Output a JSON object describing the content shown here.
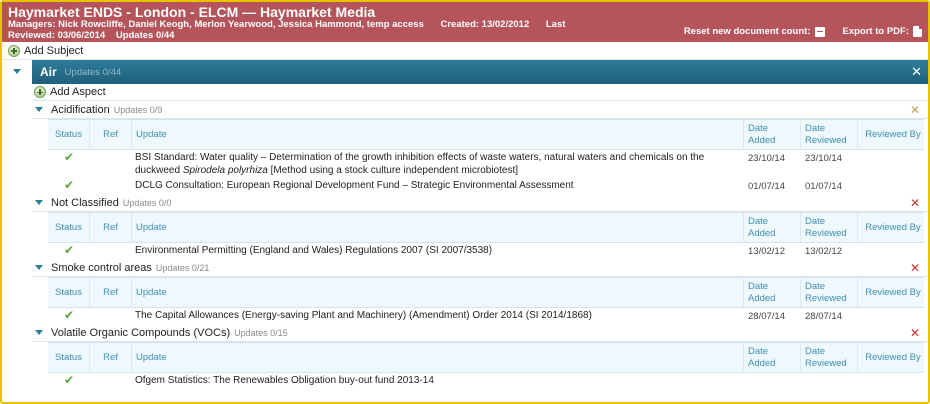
{
  "header": {
    "title": "Haymarket ENDS - London - ELCM —  Haymarket Media",
    "managers": "Managers: Nick Rowcliffe, Daniel Keogh, Merlon Yearwood, Jessica Hammond, temp access",
    "created": "Created: 13/02/2012",
    "last": "Last",
    "reviewed": "Reviewed: 03/06/2014",
    "updates": "Updates 0/44",
    "reset_label": "Reset new document count:",
    "export_label": "Export to PDF:"
  },
  "add_subject_label": "Add Subject",
  "subject": {
    "name": "Air",
    "count": "Updates 0/44",
    "close": "✕"
  },
  "add_aspect_label": "Add Aspect",
  "columns": {
    "status": "Status",
    "ref": "Ref",
    "update": "Update",
    "date_added_1": "Date",
    "date_added_2": "Added",
    "date_reviewed_1": "Date",
    "date_reviewed_2": "Reviewed",
    "reviewed_by": "Reviewed By"
  },
  "aspects": [
    {
      "name": "Acidification",
      "count": "Updates 0/9",
      "rows": [
        {
          "update_line1": "BSI Standard: Water quality – Determination of the growth inhibition effects of waste waters, natural waters and chemicals on the",
          "update_pre": "duckweed ",
          "update_italic": "Spirodela polyrhiza",
          "update_post": " [Method using a stock culture independent microbiotest]",
          "date_added": "23/10/14",
          "date_reviewed": "23/10/14"
        },
        {
          "update_line1": "DCLG Consultation: European Regional Development Fund – Strategic Environmental Assessment",
          "date_added": "01/07/14",
          "date_reviewed": "01/07/14"
        }
      ]
    },
    {
      "name": "Not Classified",
      "count": "Updates 0/0",
      "rows": [
        {
          "update_line1": "Environmental Permitting (England and Wales) Regulations 2007 (SI 2007/3538)",
          "date_added": "13/02/12",
          "date_reviewed": "13/02/12"
        }
      ]
    },
    {
      "name": "Smoke control areas",
      "count": "Updates 0/21",
      "rows": [
        {
          "update_line1": "The Capital Allowances (Energy-saving Plant and Machinery) (Amendment) Order 2014 (SI 2014/1868)",
          "date_added": "28/07/14",
          "date_reviewed": "28/07/14"
        }
      ]
    },
    {
      "name": "Volatile Organic Compounds (VOCs)",
      "count": "Updates 0/15",
      "rows": [
        {
          "update_line1": "Ofgem Statistics: The Renewables Obligation buy-out fund 2013-14",
          "date_added": "",
          "date_reviewed": ""
        }
      ]
    }
  ],
  "close_glyph": "✕",
  "check_glyph": "✔"
}
